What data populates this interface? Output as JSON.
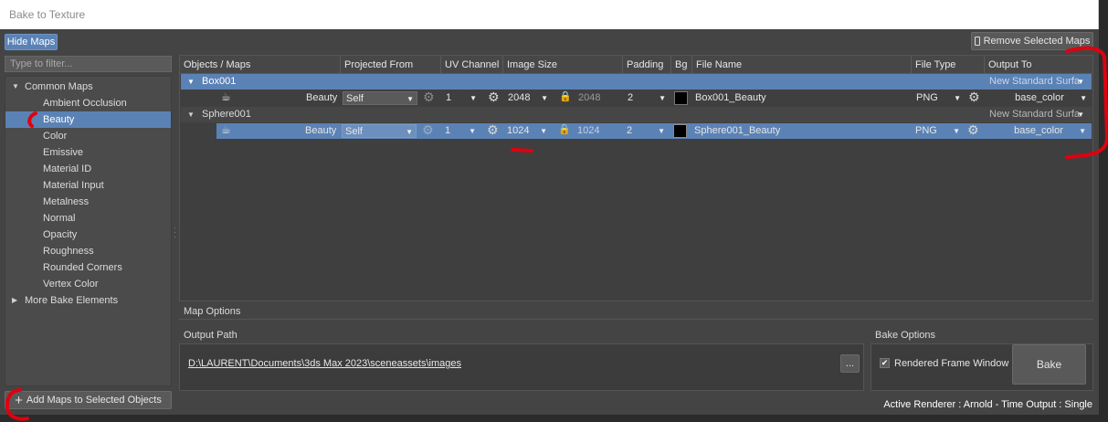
{
  "window": {
    "title": "Bake to Texture"
  },
  "toolbar": {
    "hide_maps": "Hide Maps",
    "remove_selected": "Remove Selected Maps"
  },
  "filter": {
    "placeholder": "Type to filter..."
  },
  "tree": {
    "common": "Common Maps",
    "items": [
      "Ambient Occlusion",
      "Beauty",
      "Color",
      "Emissive",
      "Material ID",
      "Material Input",
      "Metalness",
      "Normal",
      "Opacity",
      "Roughness",
      "Rounded Corners",
      "Vertex Color"
    ],
    "more": "More Bake Elements"
  },
  "add_maps": "Add Maps to Selected Objects",
  "columns": [
    "Objects / Maps",
    "Projected From",
    "UV Channel",
    "Image Size",
    "Padding",
    "Bg",
    "File Name",
    "File Type",
    "Output To"
  ],
  "objects": [
    {
      "name": "Box001",
      "output_group": "New Standard Surfa",
      "map": {
        "name": "Beauty",
        "projected": "Self",
        "uv": "1",
        "size": "2048",
        "size2": "2048",
        "padding": "2",
        "file": "Box001_Beauty",
        "type": "PNG",
        "output": "base_color"
      }
    },
    {
      "name": "Sphere001",
      "output_group": "New Standard Surfa",
      "map": {
        "name": "Beauty",
        "projected": "Self",
        "uv": "1",
        "size": "1024",
        "size2": "1024",
        "padding": "2",
        "file": "Sphere001_Beauty",
        "type": "PNG",
        "output": "base_color"
      }
    }
  ],
  "map_options": "Map Options",
  "output_path": {
    "label": "Output Path",
    "value": "D:\\LAURENT\\Documents\\3ds Max 2023\\sceneassets\\images",
    "browse": "..."
  },
  "bake_options": {
    "label": "Bake Options",
    "rendered_frame": "Rendered Frame Window",
    "bake": "Bake"
  },
  "status": "Active Renderer : Arnold  -  Time Output : Single",
  "colors": {
    "selection": "#5b82b5",
    "annotation": "#e0000f"
  }
}
